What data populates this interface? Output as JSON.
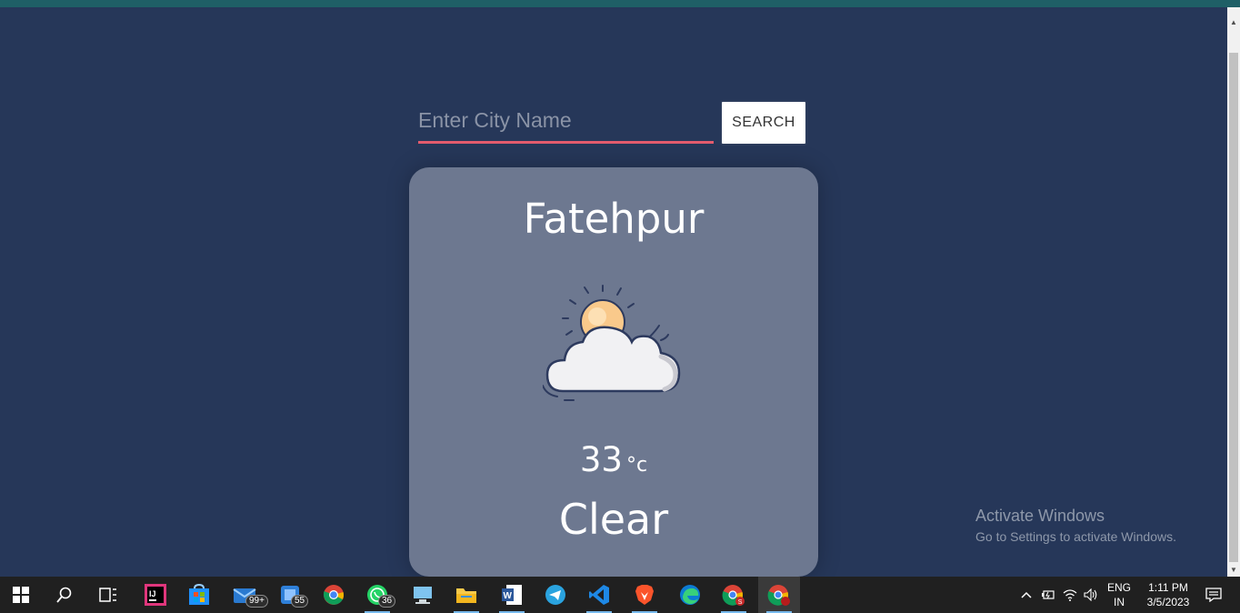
{
  "search": {
    "placeholder": "Enter City Name",
    "button_label": "SEARCH"
  },
  "weather": {
    "city": "Fatehpur",
    "temperature": "33",
    "unit": "°c",
    "condition": "Clear",
    "icon": "sun-behind-cloud-icon"
  },
  "watermark": {
    "title": "Activate Windows",
    "subtitle": "Go to Settings to activate Windows."
  },
  "taskbar": {
    "apps": [
      {
        "name": "start-icon"
      },
      {
        "name": "search-icon"
      },
      {
        "name": "task-view-icon"
      },
      {
        "name": "intellij-icon"
      },
      {
        "name": "microsoft-store-icon"
      },
      {
        "name": "mail-icon",
        "badge": "99+"
      },
      {
        "name": "app-icon",
        "badge": "55"
      },
      {
        "name": "chrome-icon"
      },
      {
        "name": "whatsapp-icon",
        "badge": "36"
      },
      {
        "name": "desktop-app-icon"
      },
      {
        "name": "file-explorer-icon"
      },
      {
        "name": "word-icon"
      },
      {
        "name": "telegram-icon"
      },
      {
        "name": "vscode-icon"
      },
      {
        "name": "brave-icon"
      },
      {
        "name": "edge-icon"
      },
      {
        "name": "chrome-profile-icon"
      },
      {
        "name": "chrome-active-icon"
      }
    ],
    "tray": {
      "language": "ENG",
      "region": "IN",
      "time": "1:11 PM",
      "date": "3/5/2023"
    }
  },
  "colors": {
    "background": "#263759",
    "card": "#6d7890",
    "input_underline": "#e35b6d",
    "taskbar": "#202020"
  }
}
